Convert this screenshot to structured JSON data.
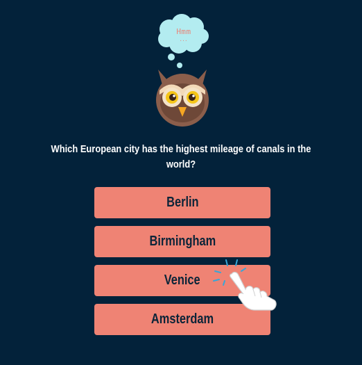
{
  "thought_bubble": {
    "text": "Hmm",
    "dots": "..."
  },
  "question": {
    "text": "Which European city has the highest mileage of canals in the world?"
  },
  "answers": [
    {
      "label": "Berlin"
    },
    {
      "label": "Birmingham"
    },
    {
      "label": "Venice"
    },
    {
      "label": "Amsterdam"
    }
  ],
  "colors": {
    "background": "#03223a",
    "answer_button": "#ef8374",
    "answer_text": "#0b2438",
    "bubble": "#b3ecf0",
    "owl_body": "#8b5e4b",
    "tap_rays": "#37a6d8"
  },
  "icons": {
    "mascot": "owl-icon",
    "thought": "thought-bubble-icon",
    "pointer": "tapping-hand-icon"
  }
}
